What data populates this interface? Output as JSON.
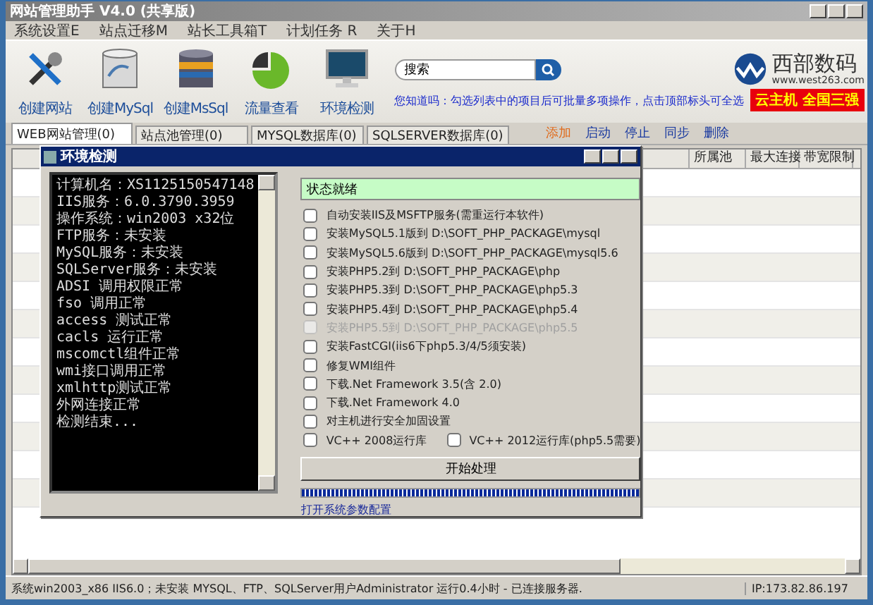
{
  "window": {
    "title": "网站管理助手 V4.0 (共享版)"
  },
  "menu": [
    "系统设置E",
    "站点迁移M",
    "站长工具箱T",
    "计划任务 R",
    "关于H"
  ],
  "toolbar": [
    {
      "label": "创建网站",
      "kind": "tools"
    },
    {
      "label": "创建MySql",
      "kind": "mysql"
    },
    {
      "label": "创建MsSql",
      "kind": "mssql"
    },
    {
      "label": "流量查看",
      "kind": "chart"
    },
    {
      "label": "环境检测",
      "kind": "monitor"
    }
  ],
  "search": {
    "value": "搜索"
  },
  "tip": "您知道吗：勾选列表中的项目后可批量多项操作，点击顶部标头可全选",
  "brand": {
    "name": "西部数码",
    "url": "www.west263.com",
    "banner": "云主机 全国三强"
  },
  "tabs": [
    {
      "label": "WEB网站管理(0)",
      "selected": true
    },
    {
      "label": "站点池管理(0)",
      "selected": false
    },
    {
      "label": "MYSQL数据库(0)",
      "selected": false
    },
    {
      "label": "SQLSERVER数据库(0)",
      "selected": false
    }
  ],
  "actions": [
    {
      "label": "添加",
      "color": "#e06a1a"
    },
    {
      "label": "启动",
      "color": "#1a3aa0"
    },
    {
      "label": "停止",
      "color": "#1a3aa0"
    },
    {
      "label": "同步",
      "color": "#1a3aa0"
    },
    {
      "label": "删除",
      "color": "#1a3aa0"
    }
  ],
  "table": {
    "columns": [
      "所属池",
      "最大连接",
      "带宽限制"
    ]
  },
  "dialog": {
    "title": "环境检测",
    "log": [
      "计算机名：XS1125150547148",
      "IIS服务：6.0.3790.3959",
      "操作系统：win2003 x32位",
      "FTP服务：未安装",
      "MySQL服务：未安装",
      "SQLServer服务：未安装",
      "ADSI 调用权限正常",
      "fso 调用正常",
      "access 测试正常",
      "cacls 运行正常",
      "mscomctl组件正常",
      "wmi接口调用正常",
      "xmlhttp测试正常",
      "外网连接正常",
      "检测结束..."
    ],
    "status": "状态就绪",
    "options": [
      {
        "label": "自动安装IIS及MSFTP服务(需重运行本软件)",
        "checked": false,
        "disabled": false
      },
      {
        "label": "安装MySQL5.1版到 D:\\SOFT_PHP_PACKAGE\\mysql",
        "checked": false,
        "disabled": false
      },
      {
        "label": "安装MySQL5.6版到 D:\\SOFT_PHP_PACKAGE\\mysql5.6",
        "checked": false,
        "disabled": false
      },
      {
        "label": "安装PHP5.2到 D:\\SOFT_PHP_PACKAGE\\php",
        "checked": false,
        "disabled": false
      },
      {
        "label": "安装PHP5.3到 D:\\SOFT_PHP_PACKAGE\\php5.3",
        "checked": false,
        "disabled": false
      },
      {
        "label": "安装PHP5.4到 D:\\SOFT_PHP_PACKAGE\\php5.4",
        "checked": false,
        "disabled": false
      },
      {
        "label": "安装PHP5.5到 D:\\SOFT_PHP_PACKAGE\\php5.5",
        "checked": false,
        "disabled": true
      },
      {
        "label": "安装FastCGI(iis6下php5.3/4/5须安装)",
        "checked": false,
        "disabled": false
      },
      {
        "label": "修复WMI组件",
        "checked": false,
        "disabled": false
      },
      {
        "label": "下载.Net Framework 3.5(含 2.0)",
        "checked": false,
        "disabled": false
      },
      {
        "label": "下载.Net Framework 4.0",
        "checked": false,
        "disabled": false
      },
      {
        "label": "对主机进行安全加固设置",
        "checked": false,
        "disabled": false
      }
    ],
    "pair": [
      {
        "label": "VC++ 2008运行库",
        "checked": false
      },
      {
        "label": "VC++ 2012运行库(php5.5需要)",
        "checked": false
      }
    ],
    "button": "开始处理",
    "progress": {
      "level": 1
    },
    "link": "打开系统参数配置"
  },
  "status_bar": {
    "message": "系统win2003_x86 IIS6.0；未安装 MYSQL、FTP、SQLServer用户Administrator 运行0.4小时 - 已连接服务器.",
    "ip": "IP:173.82.86.197"
  }
}
